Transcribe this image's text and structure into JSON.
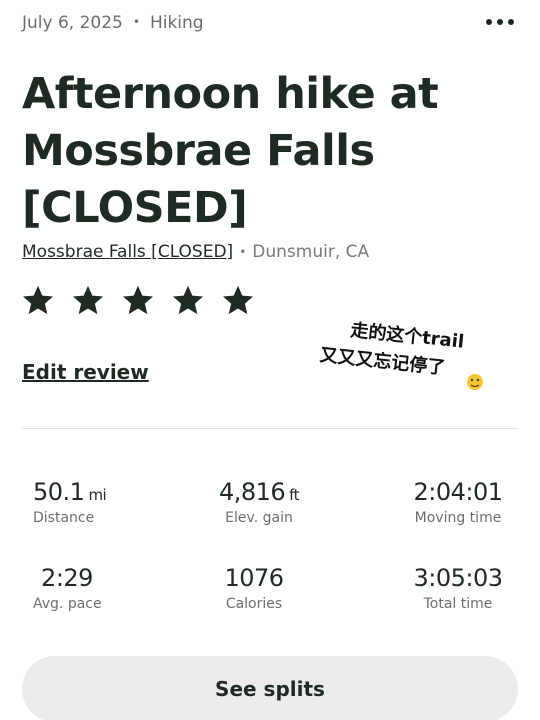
{
  "header": {
    "date": "July 6, 2025",
    "separator": "•",
    "activity_type": "Hiking"
  },
  "title": "Afternoon hike at Mossbrae Falls [CLOSED]",
  "location": {
    "trail_name": "Mossbrae Falls [CLOSED]",
    "separator": "•",
    "place": "Dunsmuir, CA"
  },
  "rating": {
    "stars": 5,
    "max": 5
  },
  "edit_review_label": "Edit review",
  "sticker": {
    "line1": "走的这个trail",
    "line2": "又又又忘记停了",
    "emoji": "🫠"
  },
  "stats": {
    "distance": {
      "value": "50.1",
      "unit": "mi",
      "label": "Distance"
    },
    "elevation": {
      "value": "4,816",
      "unit": "ft",
      "label": "Elev. gain"
    },
    "moving_time": {
      "value": "2:04:01",
      "label": "Moving time"
    },
    "avg_pace": {
      "value": "2:29",
      "label": "Avg. pace"
    },
    "calories": {
      "value": "1076",
      "label": "Calories"
    },
    "total_time": {
      "value": "3:05:03",
      "label": "Total time"
    }
  },
  "splits_button_label": "See splits",
  "colors": {
    "text_primary": "#1f2a22",
    "text_secondary": "#6d6d6d",
    "button_bg": "#ebebeb",
    "star": "#1f2a22"
  },
  "icons": {
    "more": "more-horizontal-icon",
    "star": "star-icon"
  }
}
